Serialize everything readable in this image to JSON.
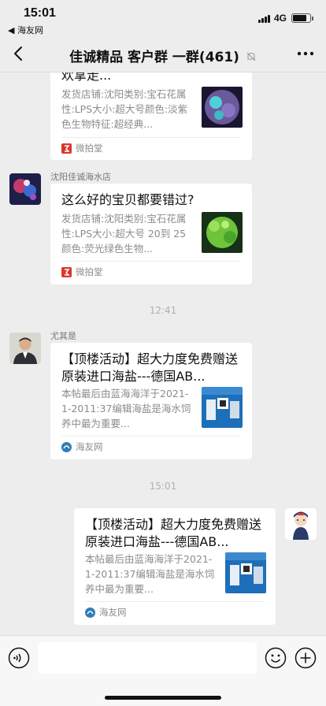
{
  "status_bar": {
    "time": "15:01",
    "back_app": "◀ 海友网",
    "network": "4G"
  },
  "nav": {
    "title": "佳诚精品 客户群 一群(461)"
  },
  "messages": [
    {
      "type": "card",
      "title": "欢拿走...",
      "desc": "发货店铺:沈阳类别:宝石花属性:LPS大小:超大号颜色:淡紫色生物特征:超经典...",
      "source": "微拍堂",
      "thumb_color": "#6a5a9a"
    },
    {
      "type": "card",
      "sender": "沈阳佳诚海水店",
      "title": "这么好的宝贝都要错过?",
      "desc": "发货店铺:沈阳类别:宝石花属性:LPS大小:超大号 20到 25颜色:荧光绿色生物...",
      "source": "微拍堂",
      "thumb_color": "#6fc43a"
    },
    {
      "type": "timestamp",
      "text": "12:41"
    },
    {
      "type": "card",
      "sender": "尤其是",
      "title": "【顶楼活动】超大力度免费赠送原装进口海盐---德国AB...",
      "desc": "本帖最后由蓝海海洋于2021-1-2011:37编辑海盐是海水饲养中最为重要...",
      "source": "海友网",
      "thumb_color": "#1c6fb8"
    },
    {
      "type": "timestamp",
      "text": "15:01"
    },
    {
      "type": "card",
      "self": true,
      "title": "【顶楼活动】超大力度免费赠送原装进口海盐---德国AB...",
      "desc": "本帖最后由蓝海海洋于2021-1-2011:37编辑海盐是海水饲养中最为重要...",
      "source": "海友网",
      "thumb_color": "#1c6fb8"
    }
  ],
  "colors": {
    "background": "#ededed",
    "card": "#ffffff",
    "weipaitang_red": "#d9372a",
    "haiyou_blue": "#2f7fb5"
  }
}
